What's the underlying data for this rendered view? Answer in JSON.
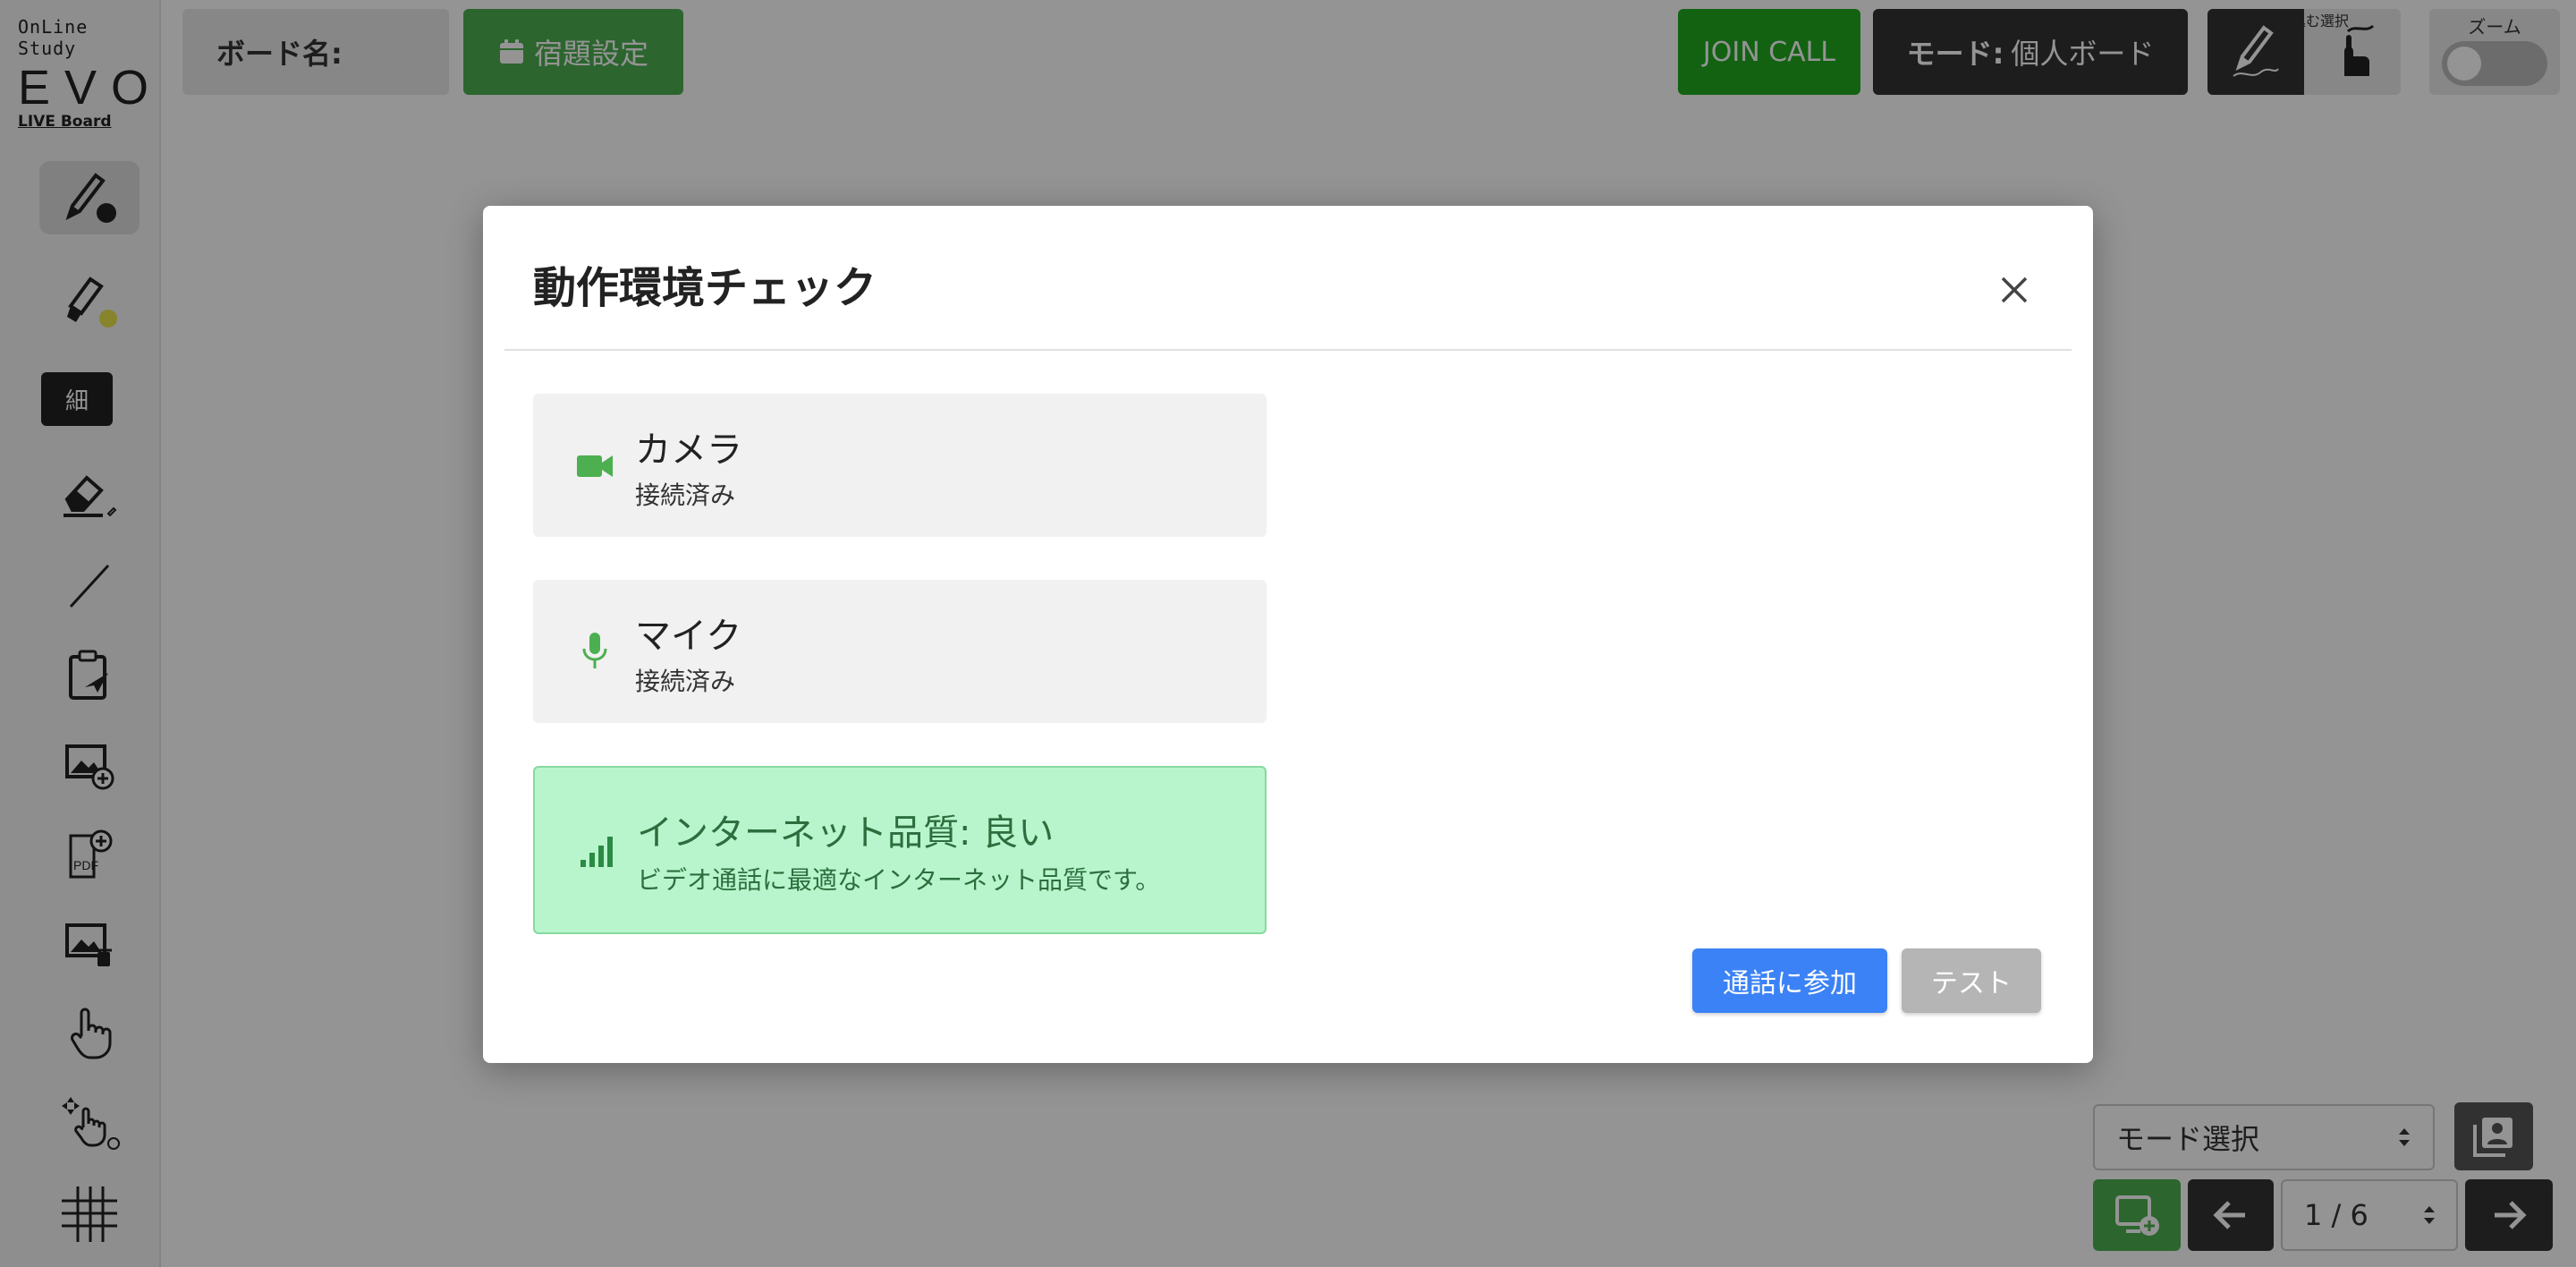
{
  "logo": {
    "sub": "OnLine Study",
    "main": "EVO",
    "tag": "LIVE Board"
  },
  "toolbar": {
    "board_name_label": "ボード名:",
    "homework_label": "宿題設定",
    "join_call_label": "JOIN CALL",
    "mode_prefix": "モード:",
    "mode_value": "個人ボード",
    "pen_select_label": "書き込む選択",
    "zoom_label": "ズーム",
    "zoom_enabled": false
  },
  "sidebar": {
    "tools": [
      {
        "name": "pen",
        "icon": "pen-icon",
        "active": true,
        "color": "#222222"
      },
      {
        "name": "marker",
        "icon": "marker-icon",
        "active": false,
        "color": "#e8e34a"
      },
      {
        "name": "line-width",
        "label": "細"
      },
      {
        "name": "eraser",
        "icon": "eraser-icon"
      },
      {
        "name": "line",
        "icon": "line-icon"
      },
      {
        "name": "clipboard-send",
        "icon": "clipboard-send-icon"
      },
      {
        "name": "add-image",
        "icon": "image-add-icon"
      },
      {
        "name": "add-pdf",
        "icon": "pdf-add-icon"
      },
      {
        "name": "delete-image",
        "icon": "image-delete-icon"
      },
      {
        "name": "hand",
        "icon": "hand-pointer-icon"
      },
      {
        "name": "move",
        "icon": "move-hand-icon"
      },
      {
        "name": "grid",
        "icon": "grid-icon"
      }
    ]
  },
  "bottom": {
    "mode_select_value": "モード選択",
    "page_value": "1 / 6"
  },
  "modal": {
    "title": "動作環境チェック",
    "checks": [
      {
        "icon": "video-camera-icon",
        "title": "カメラ",
        "status": "接続済み"
      },
      {
        "icon": "microphone-icon",
        "title": "マイク",
        "status": "接続済み"
      },
      {
        "icon": "signal-icon",
        "title": "インターネット品質: 良い",
        "status": "ビデオ通話に最適なインターネット品質です。"
      }
    ],
    "join_label": "通話に参加",
    "test_label": "テスト"
  },
  "colors": {
    "accent_green": "#4caf50",
    "join_call_green": "#1faa1f",
    "primary_blue": "#3b82f6",
    "success_bg": "#b8f5cc",
    "icon_green": "#4caf50"
  }
}
